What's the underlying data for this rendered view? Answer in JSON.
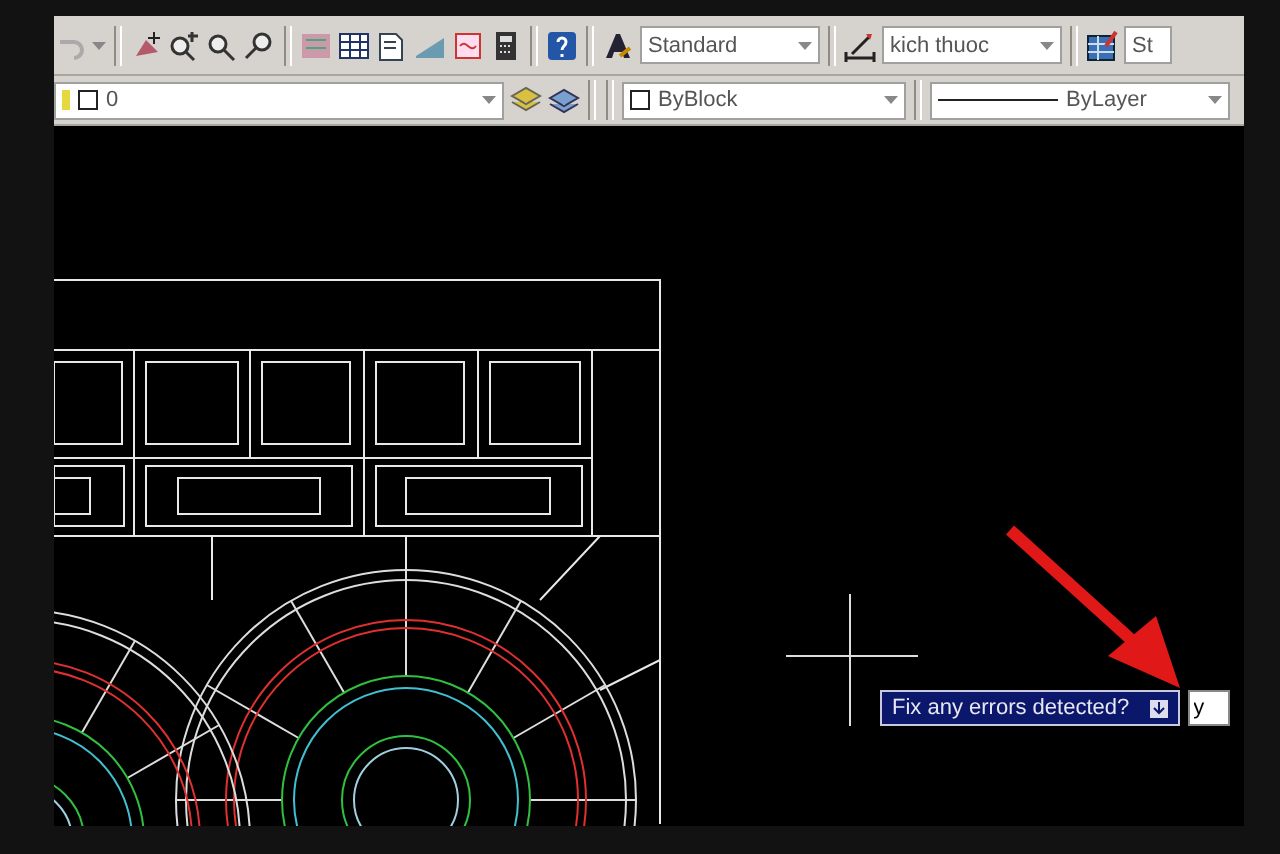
{
  "toolbar_row_1": {
    "style_combos": [
      {
        "kind": "text",
        "value": "Standard"
      },
      {
        "kind": "dimension",
        "value": "kich thuoc"
      },
      {
        "kind": "table",
        "value": "St"
      }
    ]
  },
  "toolbar_row_2": {
    "layer_combo": {
      "value": "0"
    },
    "color_combo": {
      "value": "ByBlock"
    },
    "linetype_combo": {
      "value": "ByLayer"
    }
  },
  "command_prompt": {
    "text": "Fix any errors detected?",
    "value": "y"
  }
}
